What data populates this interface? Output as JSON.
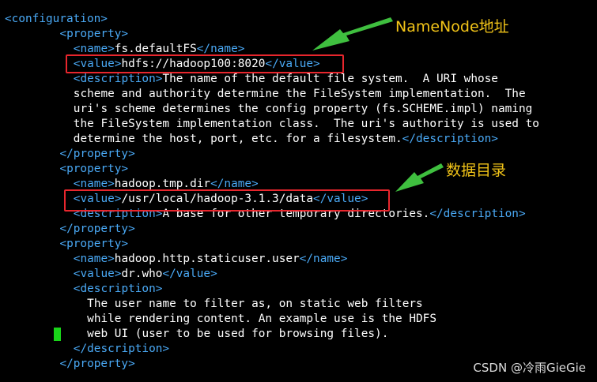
{
  "code_lines": [
    {
      "indent": 0,
      "parts": [
        {
          "t": "tag",
          "v": "<configuration>"
        }
      ]
    },
    {
      "indent": 8,
      "parts": [
        {
          "t": "tag",
          "v": "<property>"
        }
      ]
    },
    {
      "indent": 10,
      "parts": [
        {
          "t": "tag",
          "v": "<name>"
        },
        {
          "t": "txt",
          "v": "fs.defaultFS"
        },
        {
          "t": "tag",
          "v": "</name>"
        }
      ]
    },
    {
      "indent": 10,
      "parts": [
        {
          "t": "tag",
          "v": "<value>"
        },
        {
          "t": "txt",
          "v": "hdfs://hadoop100:8020"
        },
        {
          "t": "tag",
          "v": "</value>"
        }
      ]
    },
    {
      "indent": 10,
      "parts": [
        {
          "t": "tag",
          "v": "<description>"
        },
        {
          "t": "txt",
          "v": "The name of the default file system.  A URI whose"
        }
      ]
    },
    {
      "indent": 10,
      "parts": [
        {
          "t": "txt",
          "v": "scheme and authority determine the FileSystem implementation.  The"
        }
      ]
    },
    {
      "indent": 10,
      "parts": [
        {
          "t": "txt",
          "v": "uri's scheme determines the config property (fs.SCHEME.impl) naming"
        }
      ]
    },
    {
      "indent": 10,
      "parts": [
        {
          "t": "txt",
          "v": "the FileSystem implementation class.  The uri's authority is used to"
        }
      ]
    },
    {
      "indent": 10,
      "parts": [
        {
          "t": "txt",
          "v": "determine the host, port, etc. for a filesystem."
        },
        {
          "t": "tag",
          "v": "</description>"
        }
      ]
    },
    {
      "indent": 8,
      "parts": [
        {
          "t": "tag",
          "v": "</property>"
        }
      ]
    },
    {
      "indent": 8,
      "parts": [
        {
          "t": "tag",
          "v": "<property>"
        }
      ]
    },
    {
      "indent": 10,
      "parts": [
        {
          "t": "tag",
          "v": "<name>"
        },
        {
          "t": "txt",
          "v": "hadoop.tmp.dir"
        },
        {
          "t": "tag",
          "v": "</name>"
        }
      ]
    },
    {
      "indent": 10,
      "parts": [
        {
          "t": "tag",
          "v": "<value>"
        },
        {
          "t": "txt",
          "v": "/usr/local/hadoop-3.1.3/data"
        },
        {
          "t": "tag",
          "v": "</value>"
        }
      ]
    },
    {
      "indent": 10,
      "parts": [
        {
          "t": "tag",
          "v": "<description>"
        },
        {
          "t": "txt",
          "v": "A base for other temporary directories."
        },
        {
          "t": "tag",
          "v": "</description>"
        }
      ]
    },
    {
      "indent": 8,
      "parts": [
        {
          "t": "tag",
          "v": "</property>"
        }
      ]
    },
    {
      "indent": 8,
      "parts": [
        {
          "t": "tag",
          "v": "<property>"
        }
      ]
    },
    {
      "indent": 10,
      "parts": [
        {
          "t": "tag",
          "v": "<name>"
        },
        {
          "t": "txt",
          "v": "hadoop.http.staticuser.user"
        },
        {
          "t": "tag",
          "v": "</name>"
        }
      ]
    },
    {
      "indent": 10,
      "parts": [
        {
          "t": "tag",
          "v": "<value>"
        },
        {
          "t": "txt",
          "v": "dr.who"
        },
        {
          "t": "tag",
          "v": "</value>"
        }
      ]
    },
    {
      "indent": 10,
      "parts": [
        {
          "t": "tag",
          "v": "<description>"
        }
      ]
    },
    {
      "indent": 12,
      "parts": [
        {
          "t": "txt",
          "v": "The user name to filter as, on static web filters"
        }
      ]
    },
    {
      "indent": 12,
      "parts": [
        {
          "t": "txt",
          "v": "while rendering content. An example use is the HDFS"
        }
      ]
    },
    {
      "indent": 12,
      "parts": [
        {
          "t": "txt",
          "v": "web UI (user to be used for browsing files)."
        }
      ]
    },
    {
      "indent": 10,
      "parts": [
        {
          "t": "tag",
          "v": "</description>"
        }
      ]
    },
    {
      "indent": 8,
      "parts": [
        {
          "t": "tag",
          "v": "</property>"
        }
      ]
    }
  ],
  "annotations": {
    "namenode_label": "NameNode地址",
    "datadir_label": "数据目录"
  },
  "watermark": "CSDN @冷雨GieGie",
  "colors": {
    "background": "#000000",
    "tag": "#4aa9f5",
    "text": "#ffffff",
    "highlight_box": "#e8262d",
    "arrow": "#3fbf3f",
    "annotation": "#f2c418",
    "cursor": "#19d419"
  }
}
